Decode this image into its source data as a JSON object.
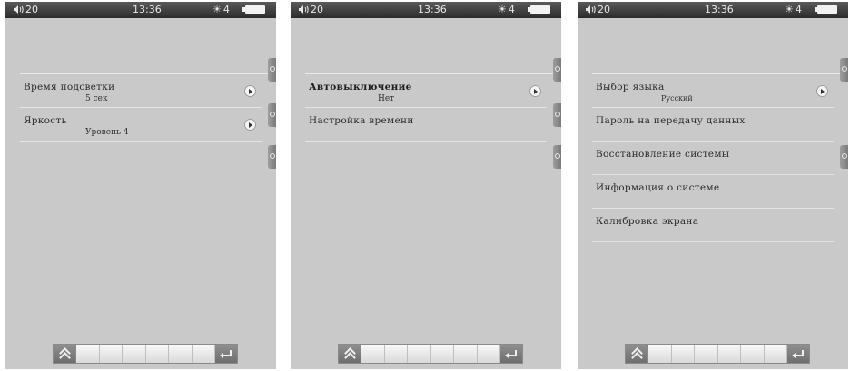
{
  "status_bar": {
    "volume": "20",
    "time": "13:36",
    "brightness": "4"
  },
  "screens": [
    {
      "items": [
        {
          "label": "Время подсветки",
          "value": "5 сек"
        },
        {
          "label": "Яркость",
          "value": "Уровень 4"
        }
      ]
    },
    {
      "items": [
        {
          "label": "Автовыключение",
          "value": "Нет"
        },
        {
          "label": "Настройка времени"
        }
      ]
    },
    {
      "items": [
        {
          "label": "Выбор языка",
          "value": "Русский"
        },
        {
          "label": "Пароль на передачу данных"
        },
        {
          "label": "Восстановление системы"
        },
        {
          "label": "Информация о системе"
        },
        {
          "label": "Калибровка экрана"
        }
      ]
    }
  ],
  "icons": {
    "volume": "speaker-icon",
    "brightness": "sun-icon",
    "battery": "battery-icon",
    "item_arrow": "circle-arrow-right-icon",
    "side_tab": "side-tab-icon",
    "home": "double-chevron-up-icon",
    "back": "return-arrow-icon"
  }
}
